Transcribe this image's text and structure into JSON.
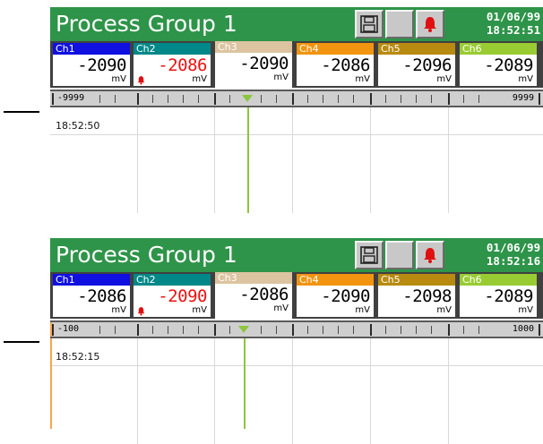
{
  "colors": {
    "header_bg": "#2e9449",
    "ch1": "#1010e0",
    "ch2": "#008888",
    "ch3": "#dcc4a0",
    "ch4": "#f29410",
    "ch5": "#b88a10",
    "ch6": "#99cc33",
    "alarm_text": "#ee1111",
    "trace_green": "#8cc63e",
    "trace_orange": "#f7a54a"
  },
  "icons": {
    "save": "floppy-disk-icon",
    "blank": "blank-button",
    "alarm": "bell-icon"
  },
  "panels": [
    {
      "title": "Process Group 1",
      "date": "01/06/99",
      "time": "18:52:51",
      "channels": [
        {
          "label": "Ch1",
          "value": "-2090",
          "unit": "mV",
          "alarm": false
        },
        {
          "label": "Ch2",
          "value": "-2086",
          "unit": "mV",
          "alarm": true
        },
        {
          "label": "Ch3",
          "value": "-2090",
          "unit": "mV",
          "alarm": false
        },
        {
          "label": "Ch4",
          "value": "-2086",
          "unit": "mV",
          "alarm": false
        },
        {
          "label": "Ch5",
          "value": "-2096",
          "unit": "mV",
          "alarm": false
        },
        {
          "label": "Ch6",
          "value": "-2089",
          "unit": "mV",
          "alarm": false
        }
      ],
      "scale_min": "-9999",
      "scale_max": "9999",
      "timestamp": "18:52:50"
    },
    {
      "title": "Process Group 1",
      "date": "01/06/99",
      "time": "18:52:16",
      "channels": [
        {
          "label": "Ch1",
          "value": "-2086",
          "unit": "mV",
          "alarm": false
        },
        {
          "label": "Ch2",
          "value": "-2090",
          "unit": "mV",
          "alarm": true
        },
        {
          "label": "Ch3",
          "value": "-2086",
          "unit": "mV",
          "alarm": false
        },
        {
          "label": "Ch4",
          "value": "-2090",
          "unit": "mV",
          "alarm": false
        },
        {
          "label": "Ch5",
          "value": "-2098",
          "unit": "mV",
          "alarm": false
        },
        {
          "label": "Ch6",
          "value": "-2089",
          "unit": "mV",
          "alarm": false
        }
      ],
      "scale_min": "-100",
      "scale_max": "1000",
      "timestamp": "18:52:15"
    }
  ]
}
